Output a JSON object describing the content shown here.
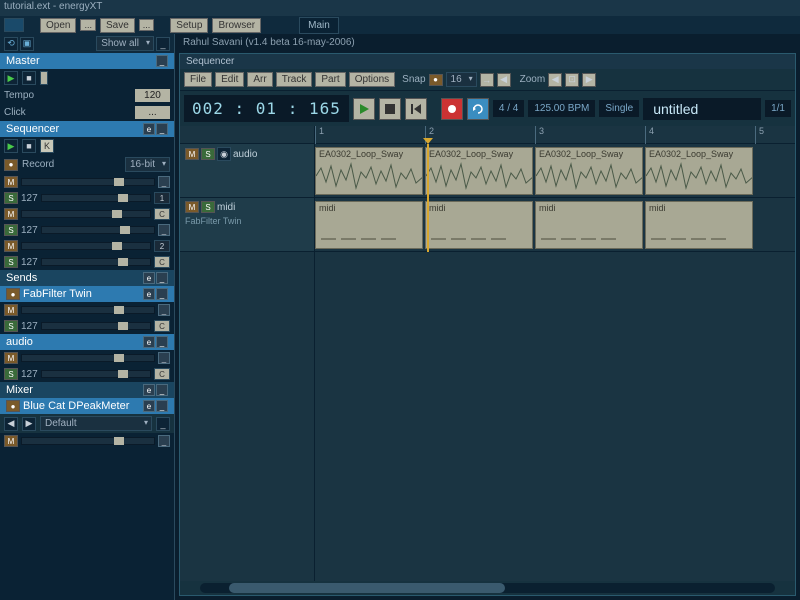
{
  "window": {
    "title": "tutorial.ext - energyXT"
  },
  "topbar": {
    "open": "Open",
    "save": "Save",
    "setup": "Setup",
    "browser": "Browser",
    "main": "Main"
  },
  "left": {
    "show_all": "Show all",
    "master": {
      "title": "Master",
      "tempo_label": "Tempo",
      "tempo": "120",
      "click_label": "Click"
    },
    "sequencer": {
      "title": "Sequencer",
      "e": "e",
      "record_label": "Record",
      "bits": "16-bit",
      "ch": [
        "127",
        "127",
        "127",
        "127"
      ],
      "chan_n": [
        "1",
        "C",
        "2",
        "C"
      ]
    },
    "sends": {
      "title": "Sends",
      "e": "e"
    },
    "fab": {
      "title": "FabFilter Twin",
      "e": "e",
      "val": "127",
      "c": "C"
    },
    "audio": {
      "title": "audio",
      "e": "e"
    },
    "mixer": {
      "title": "Mixer",
      "e": "e"
    },
    "bluecat": {
      "title": "Blue Cat DPeakMeter",
      "e": "e"
    },
    "default": "Default"
  },
  "author": "Rahul Savani (v1.4 beta 16-may-2006)",
  "seq": {
    "title": "Sequencer",
    "menu": {
      "file": "File",
      "edit": "Edit",
      "arr": "Arr",
      "track": "Track",
      "part": "Part",
      "options": "Options",
      "snap": "Snap",
      "snap_val": "16",
      "zoom": "Zoom"
    },
    "transport": {
      "time": "002 : 01 : 165",
      "sig": "4 / 4",
      "bpm": "125.00 BPM",
      "mode": "Single",
      "song": "untitled",
      "page": "1/1"
    },
    "ruler": [
      "1",
      "2",
      "3",
      "4",
      "5"
    ],
    "tracks": [
      {
        "name": "audio",
        "sub": "",
        "clips": [
          "EA0302_Loop_Sway",
          "EA0302_Loop_Sway",
          "EA0302_Loop_Sway",
          "EA0302_Loop_Sway"
        ],
        "type": "audio"
      },
      {
        "name": "midi",
        "sub": "FabFilter Twin",
        "clips": [
          "midi",
          "midi",
          "midi",
          "midi"
        ],
        "type": "midi"
      }
    ],
    "playhead_bar": 2
  }
}
